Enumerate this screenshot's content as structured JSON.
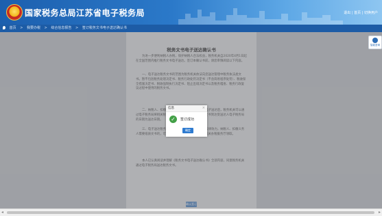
{
  "header": {
    "title": "国家税务总局江苏省电子税务局",
    "user_links": "退出 | 首页 | 切换用户"
  },
  "breadcrumb": {
    "items": [
      "首页",
      "我要办税",
      "综合信息报告",
      "签订税务文书电子送达确认书"
    ]
  },
  "document": {
    "title": "税务文书电子送达确认书",
    "paragraphs": [
      "为进一步便利纳税人办税，保护纳税人合法权益，税务机关自2020年4月1日起在全国范围内推行税务文书电子送达。签订本确认书前，请您审慎阅读以下内容。",
      "一、电子送达税务文书的范围为税务机关依法向您送达管理中税务执法类文书。暂不包括税务处理决定书、税务行政处罚决定书（不含简易程序处罚）、税收保全措施决定书、税收强制执行决定书、阻止出境决定书以及税务稽查、税务行政复议过程中使用的税务文书。",
      "二、纳税人、扣缴义务人或其他当事人同意接受电子送达后，税务机关可以通过电子税务局将相关税务文书送达至受送达人，税务文书到达受送达人电子税务局的日期为送达日期。",
      "三、电子送达税务文书与其他送达方式具有同等法律效力。纳税人、扣缴义务人需要纸质文书的，可自行下载打印，也可以到税务机关办税服务厅领取。",
      "本人已认真阅读并理解《税务文书电子送达确认书》全部内容，同意税务机关通过电子税务局送达税务文书。"
    ],
    "confirm_button": "确认签订"
  },
  "dialog": {
    "title": "信息",
    "close": "×",
    "message": "签订成功",
    "ok_button": "确定",
    "status_icon": "check-circle-icon",
    "status_color": "#43a047"
  },
  "float_widget": {
    "label": "智能咨询"
  },
  "colors": {
    "header_blue": "#1c5fae",
    "dialog_button": "#2e7bd0"
  }
}
